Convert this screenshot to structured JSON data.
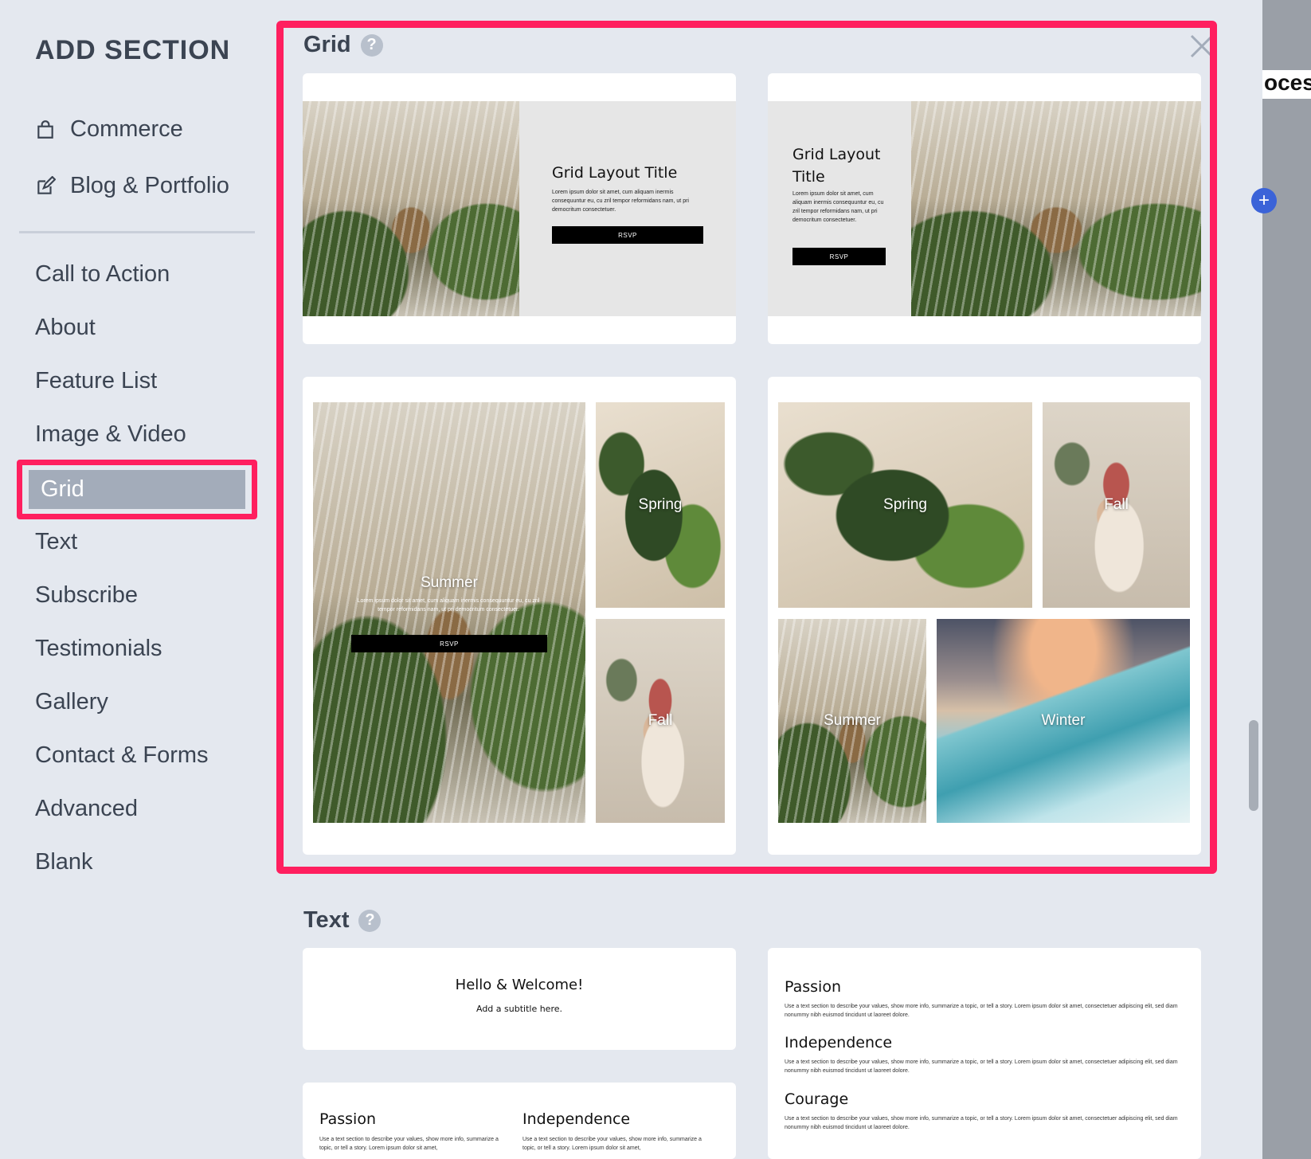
{
  "sidebar": {
    "title": "ADD SECTION",
    "top_links": [
      {
        "label": "Commerce",
        "icon": "shopping-bag-icon"
      },
      {
        "label": "Blog & Portfolio",
        "icon": "edit-icon"
      }
    ],
    "items": [
      {
        "label": "Call to Action"
      },
      {
        "label": "About"
      },
      {
        "label": "Feature List"
      },
      {
        "label": "Image & Video"
      },
      {
        "label": "Grid",
        "active": true
      },
      {
        "label": "Text"
      },
      {
        "label": "Subscribe"
      },
      {
        "label": "Testimonials"
      },
      {
        "label": "Gallery"
      },
      {
        "label": "Contact & Forms"
      },
      {
        "label": "Advanced"
      },
      {
        "label": "Blank"
      }
    ]
  },
  "grid_section": {
    "title": "Grid",
    "help": "?",
    "cards": [
      {
        "title": "Grid Layout Title",
        "body": "Lorem ipsum dolor sit amet, cum aliquam inermis consequuntur eu, cu zril tempor reformidans nam, ut pri democritum consectetuer.",
        "button": "RSVP"
      },
      {
        "title": "Grid Layout Title",
        "body": "Lorem ipsum dolor sit amet, cum aliquam inermis consequuntur eu, cu zril tempor reformidans nam, ut pri democritum consectetuer.",
        "button": "RSVP"
      },
      {
        "tiles": [
          "Summer",
          "Spring",
          "Fall"
        ],
        "summer_body": "Lorem ipsum dolor sit amet, cum aliquam inermis consequuntur eu, cu zril tempor reformidans nam, ut pri democritum consectetuer.",
        "button": "RSVP"
      },
      {
        "tiles": [
          "Spring",
          "Fall",
          "Summer",
          "Winter"
        ]
      }
    ]
  },
  "text_section": {
    "title": "Text",
    "help": "?",
    "welcome": {
      "title": "Hello & Welcome!",
      "subtitle": "Add a subtitle here."
    },
    "values": [
      {
        "title": "Passion",
        "body": "Use a text section to describe your values, show more info, summarize a topic, or tell a story. Lorem ipsum dolor sit amet, consectetuer adipiscing elit, sed diam nonummy nibh euismod tincidunt ut laoreet dolore."
      },
      {
        "title": "Independence",
        "body": "Use a text section to describe your values, show more info, summarize a topic, or tell a story. Lorem ipsum dolor sit amet, consectetuer adipiscing elit, sed diam nonummy nibh euismod tincidunt ut laoreet dolore."
      },
      {
        "title": "Courage",
        "body": "Use a text section to describe your values, show more info, summarize a topic, or tell a story. Lorem ipsum dolor sit amet, consectetuer adipiscing elit, sed diam nonummy nibh euismod tincidunt ut laoreet dolore."
      }
    ],
    "columns": [
      {
        "title": "Passion",
        "body": "Use a text section to describe your values, show more info, summarize a topic, or tell a story. Lorem ipsum dolor sit amet,"
      },
      {
        "title": "Independence",
        "body": "Use a text section to describe your values, show more info, summarize a topic, or tell a story. Lorem ipsum dolor sit amet,"
      }
    ]
  },
  "right_peek": {
    "text": "oces"
  },
  "colors": {
    "highlight": "#ff1f5f",
    "active_bg": "#a3acba",
    "panel_bg": "#e4e8ef",
    "accent": "#3b63d8"
  }
}
